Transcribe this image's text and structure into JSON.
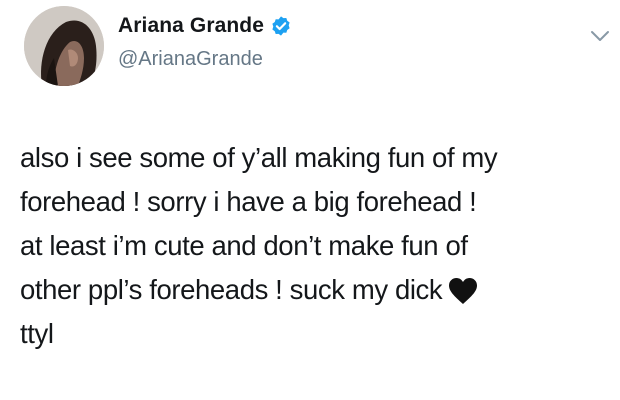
{
  "author": {
    "display_name": "Ariana Grande",
    "handle": "@ArianaGrande",
    "verified": true,
    "verified_icon": "verified-badge-icon",
    "verified_color": "#1da1f2"
  },
  "menu": {
    "icon": "chevron-down-icon"
  },
  "tweet": {
    "lines": [
      "also i see some of y’all making fun of my",
      "forehead ! sorry i have a big forehead !",
      "at least i’m cute and don’t make fun of",
      "other ppl’s foreheads ! suck my dick",
      "ttyl"
    ],
    "emoji": "black-heart-icon"
  }
}
